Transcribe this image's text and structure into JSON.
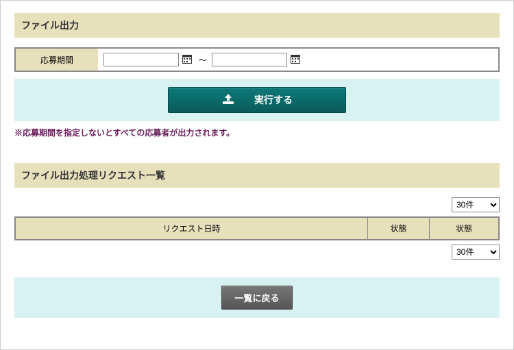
{
  "sections": {
    "export_title": "ファイル出力",
    "request_list_title": "ファイル出力処理リクエスト一覧"
  },
  "form": {
    "period_label": "応募期間",
    "date_from": "",
    "date_to": "",
    "range_separator": "～"
  },
  "actions": {
    "execute_label": "実行する",
    "back_label": "一覧に戻る"
  },
  "note": "※応募期間を指定しないとすべての応募者が出力されます。",
  "list": {
    "headers": {
      "datetime": "リクエスト日時",
      "status1": "状態",
      "status2": "状態"
    }
  },
  "pager": {
    "selected": "30件",
    "options": [
      "30件"
    ]
  }
}
